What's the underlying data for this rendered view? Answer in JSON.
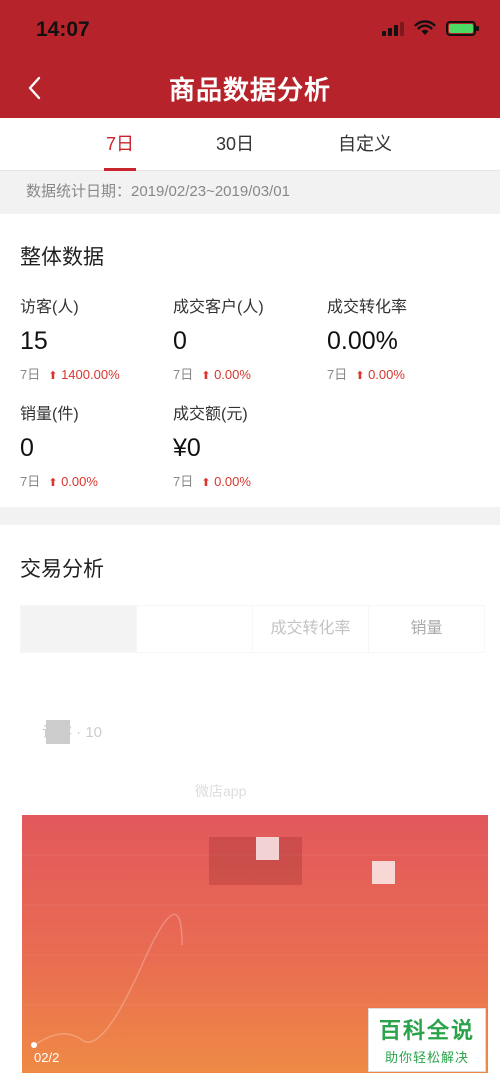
{
  "status_bar": {
    "time": "14:07"
  },
  "header": {
    "title": "商品数据分析"
  },
  "tabs": [
    {
      "label": "7日",
      "active": true
    },
    {
      "label": "30日",
      "active": false
    },
    {
      "label": "自定义",
      "active": false
    }
  ],
  "date_range": "数据统计日期：2019/02/23~2019/03/01",
  "overall": {
    "title": "整体数据",
    "metrics": [
      {
        "label": "访客(人)",
        "value": "15",
        "period": "7日",
        "change": "1400.00%"
      },
      {
        "label": "成交客户(人)",
        "value": "0",
        "period": "7日",
        "change": "0.00%"
      },
      {
        "label": "成交转化率",
        "value": "0.00%",
        "period": "7日",
        "change": "0.00%"
      },
      {
        "label": "销量(件)",
        "value": "0",
        "period": "7日",
        "change": "0.00%"
      },
      {
        "label": "成交额(元)",
        "value": "¥0",
        "period": "7日",
        "change": "0.00%"
      }
    ]
  },
  "trade": {
    "title": "交易分析",
    "tabs": [
      "",
      "",
      "成交转化率",
      "销量"
    ],
    "faded_text_1": "访客 · 10",
    "faded_text_2": "微店app",
    "chart_x_label": "02/2"
  },
  "watermark": {
    "title": "百科全说",
    "subtitle": "助你轻松解决"
  },
  "colors": {
    "brand": "#b6232a",
    "accent": "#c8252c",
    "up": "#d9362e",
    "watermark": "#2aa34a"
  },
  "icons": {
    "back": "chevron-left-icon",
    "up": "arrow-up-icon"
  }
}
